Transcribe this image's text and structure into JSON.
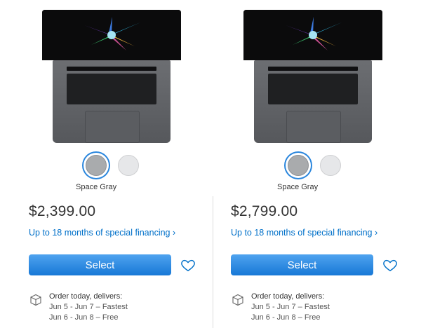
{
  "colors": {
    "accent": "#0070c9",
    "button": "#1778d6",
    "space_gray": "#a9abad",
    "silver": "#e6e7e9"
  },
  "products": [
    {
      "swatch_label": "Space Gray",
      "price": "$2,399.00",
      "financing": "Up to 18 months of special financing ›",
      "select_label": "Select",
      "delivery_title": "Order today, delivers:",
      "delivery_fast": "Jun 5 - Jun 7 – Fastest",
      "delivery_free": "Jun 6 - Jun 8 – Free"
    },
    {
      "swatch_label": "Space Gray",
      "price": "$2,799.00",
      "financing": "Up to 18 months of special financing ›",
      "select_label": "Select",
      "delivery_title": "Order today, delivers:",
      "delivery_fast": "Jun 5 - Jun 7 – Fastest",
      "delivery_free": "Jun 6 - Jun 8 – Free"
    }
  ],
  "icons": {
    "favorite": "heart-icon",
    "shipping": "box-icon"
  }
}
